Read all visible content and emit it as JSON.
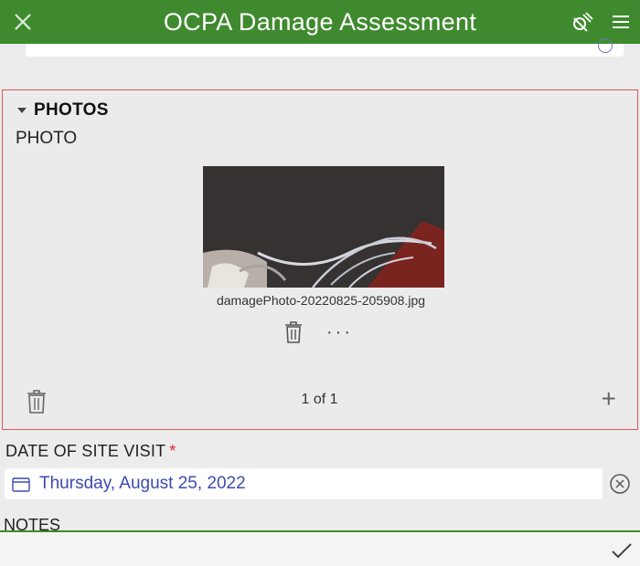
{
  "header": {
    "title": "OCPA Damage Assessment",
    "bar_color": "#3f8a2e"
  },
  "photos_section": {
    "title": "PHOTOS",
    "field_label": "PHOTO",
    "filename": "damagePhoto-20220825-205908.jpg",
    "more_label": "···",
    "counter": "1 of 1",
    "add_label": "+",
    "border_color": "#e0555b"
  },
  "site_visit": {
    "label": "DATE OF SITE VISIT",
    "required_mark": "*",
    "value": "Thursday, August 25, 2022",
    "value_color": "#3b4bb2"
  },
  "notes": {
    "label": "NOTES"
  },
  "icons": [
    "close-icon",
    "gps-icon",
    "menu-icon",
    "chevron-down-icon",
    "trash-icon",
    "more-icon",
    "plus-icon",
    "calendar-icon",
    "clear-icon",
    "checkmark-icon"
  ]
}
